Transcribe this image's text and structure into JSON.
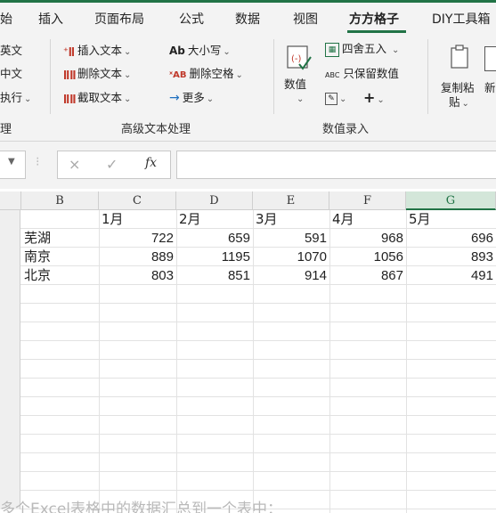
{
  "menu": {
    "tabs": [
      "始",
      "插入",
      "页面布局",
      "公式",
      "数据",
      "视图",
      "方方格子",
      "DIY工具箱"
    ],
    "active_tab": "方方格子"
  },
  "ribbon": {
    "left_cut": [
      "英文",
      "中文",
      "执行",
      "理"
    ],
    "text_tools": {
      "insert_text": "插入文本",
      "delete_text": "删除文本",
      "cut_text": "截取文本",
      "case": "大小写",
      "case_icon": "Ab",
      "delete_spaces": "删除空格",
      "more": "更多",
      "group_label": "高级文本处理"
    },
    "value_entry": {
      "value_button": "数值",
      "round": "四舍五入",
      "keep_values": "只保留数值",
      "keep_values_icon": "ABC",
      "group_label": "数值录入"
    },
    "copy_paste": {
      "label_line1": "复制粘",
      "label_line2": "贴",
      "next_cut": "新"
    }
  },
  "formula_bar": {
    "fx": "fx",
    "cancel_icon": "×",
    "confirm_icon": "✓",
    "value": ""
  },
  "sheet": {
    "columns": [
      "B",
      "C",
      "D",
      "E",
      "F",
      "G"
    ],
    "selected_column": "G",
    "rows": [
      [
        "",
        "1月",
        "2月",
        "3月",
        "4月",
        "5月"
      ],
      [
        "芜湖",
        "722",
        "659",
        "591",
        "968",
        "696"
      ],
      [
        "南京",
        "889",
        "1195",
        "1070",
        "1056",
        "893"
      ],
      [
        "北京",
        "803",
        "851",
        "914",
        "867",
        "491"
      ]
    ],
    "empty_row_count": 12
  },
  "footer_caption": "多个Excel表格中的数据汇总到一个表中：",
  "colors": {
    "accent": "#217346",
    "icon_red": "#c0392b",
    "icon_blue": "#1f6fbf"
  }
}
